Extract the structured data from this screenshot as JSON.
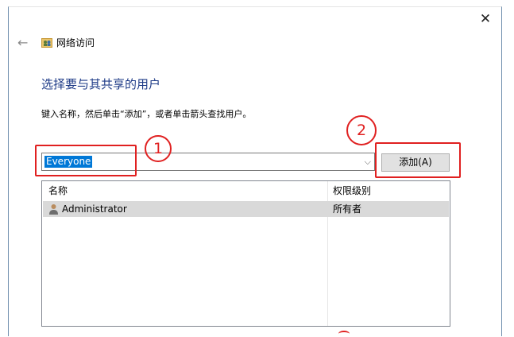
{
  "window": {
    "title": "网络访问",
    "close_glyph": "✕",
    "back_glyph": "←"
  },
  "main": {
    "heading": "选择要与其共享的用户",
    "instruction": "键入名称，然后单击“添加”，或者单击箭头查找用户。",
    "combo_value": "Everyone",
    "combo_arrow": "⌵",
    "add_button": "添加(A)"
  },
  "list": {
    "columns": [
      "名称",
      "权限级别"
    ],
    "rows": [
      {
        "name": "Administrator",
        "permission": "所有者",
        "icon": "user-icon",
        "selected": true
      }
    ]
  },
  "annotations": {
    "step1": "1",
    "step2": "2",
    "color": "#e02020"
  }
}
